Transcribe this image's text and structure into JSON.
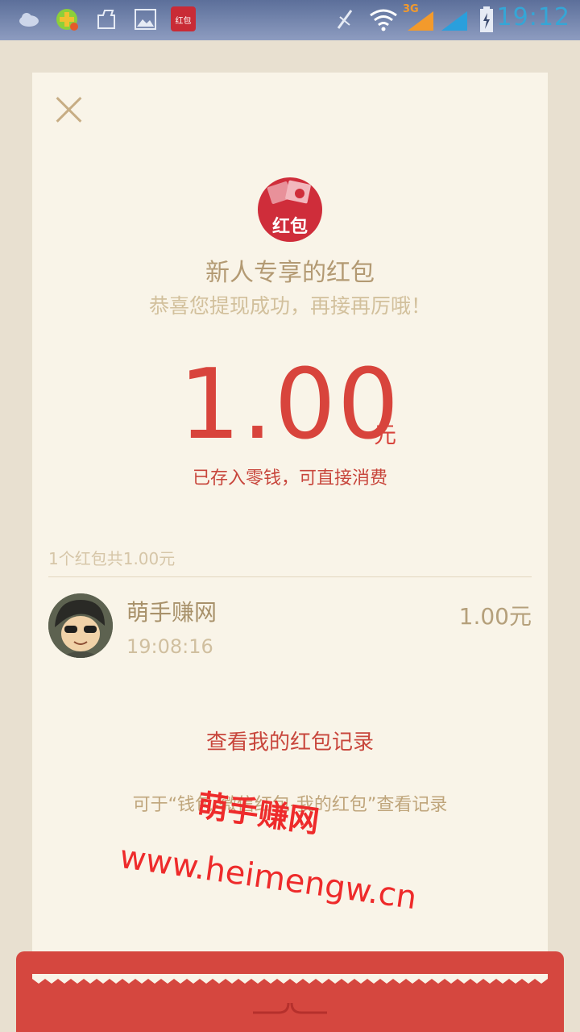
{
  "status_bar": {
    "time": "19:12",
    "network_label": "3G",
    "app_badge": "红包"
  },
  "packet": {
    "logo_text": "红包",
    "title": "新人专享的红包",
    "subtitle": "恭喜您提现成功，再接再厉哦！",
    "amount": "1.00",
    "unit": "元",
    "note": "已存入零钱，可直接消费",
    "summary": "1个红包共1.00元",
    "sender": {
      "name": "萌手赚网",
      "time": "19:08:16",
      "amount": "1.00元"
    },
    "view_records_label": "查看我的红包记录",
    "hint": "可于“钱包-微信红包-我的红包”查看记录"
  },
  "watermark": {
    "line1": "萌手赚网",
    "line2": "www.heimengw.cn"
  },
  "colors": {
    "accent_red": "#d8443c",
    "gold": "#b39a73",
    "background": "#f9f4e8"
  }
}
